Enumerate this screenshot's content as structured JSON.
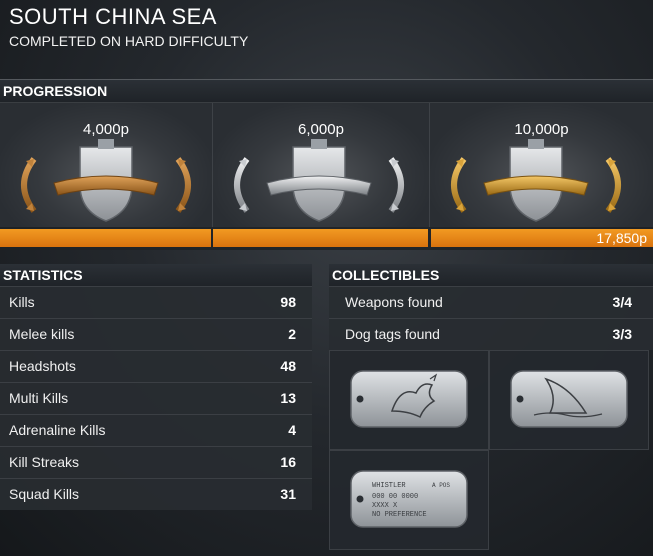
{
  "header": {
    "title": "SOUTH CHINA SEA",
    "subtitle": "COMPLETED ON HARD DIFFICULTY"
  },
  "progression": {
    "title": "PROGRESSION",
    "tiers": [
      {
        "points": "4,000p",
        "medal": "bronze-anchor-medal-icon"
      },
      {
        "points": "6,000p",
        "medal": "silver-anchor-medal-icon"
      },
      {
        "points": "10,000p",
        "medal": "gold-anchor-medal-icon"
      }
    ],
    "total": "17,850p",
    "progress_fraction": 1.0,
    "colors": {
      "bar": "#f0961f",
      "bronze": "#b7782f",
      "silver": "#b9bcbf",
      "gold": "#d39a2a"
    }
  },
  "statistics": {
    "title": "STATISTICS",
    "rows": [
      {
        "label": "Kills",
        "value": "98"
      },
      {
        "label": "Melee kills",
        "value": "2"
      },
      {
        "label": "Headshots",
        "value": "48"
      },
      {
        "label": "Multi Kills",
        "value": "13"
      },
      {
        "label": "Adrenaline Kills",
        "value": "4"
      },
      {
        "label": "Kill Streaks",
        "value": "16"
      },
      {
        "label": "Squad Kills",
        "value": "31"
      }
    ]
  },
  "collectibles": {
    "title": "COLLECTIBLES",
    "rows": [
      {
        "label": "Weapons found",
        "value": "3/4"
      },
      {
        "label": "Dog tags found",
        "value": "3/3"
      }
    ],
    "dogtags": [
      {
        "icon": "dragon-dogtag-icon"
      },
      {
        "icon": "shark-fin-dogtag-icon"
      },
      {
        "icon": "text-dogtag-icon",
        "lines": [
          "WHISTLER",
          "000 00 0000",
          "XXXX X",
          "NO PREFERENCE"
        ],
        "blood": "A POS"
      }
    ]
  }
}
